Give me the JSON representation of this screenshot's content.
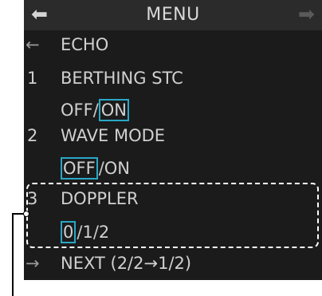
{
  "header": {
    "title": "MENU",
    "back_icon": "arrow-left-icon",
    "forward_icon": "arrow-right-icon"
  },
  "menu": {
    "echo": {
      "glyph": "←",
      "label": "ECHO"
    },
    "items": [
      {
        "number": "1",
        "label": "BERTHING STC",
        "options": [
          {
            "text": "OFF",
            "selected": false
          },
          {
            "text": "ON",
            "selected": true
          }
        ]
      },
      {
        "number": "2",
        "label": "WAVE MODE",
        "options": [
          {
            "text": "OFF",
            "selected": true
          },
          {
            "text": "ON",
            "selected": false
          }
        ]
      },
      {
        "number": "3",
        "label": "DOPPLER",
        "options": [
          {
            "text": "0",
            "selected": true
          },
          {
            "text": "1",
            "selected": false
          },
          {
            "text": "2",
            "selected": false
          }
        ]
      }
    ],
    "next": {
      "glyph": "→",
      "label": "NEXT (2/2→1/2)"
    },
    "separator": "/"
  },
  "colors": {
    "panel_bg": "#1b1b1b",
    "header_bg": "#2b2b2b",
    "text": "#d0d0d0",
    "selection_box": "#2aa7c6",
    "highlight_dashed": "#ffffff"
  }
}
